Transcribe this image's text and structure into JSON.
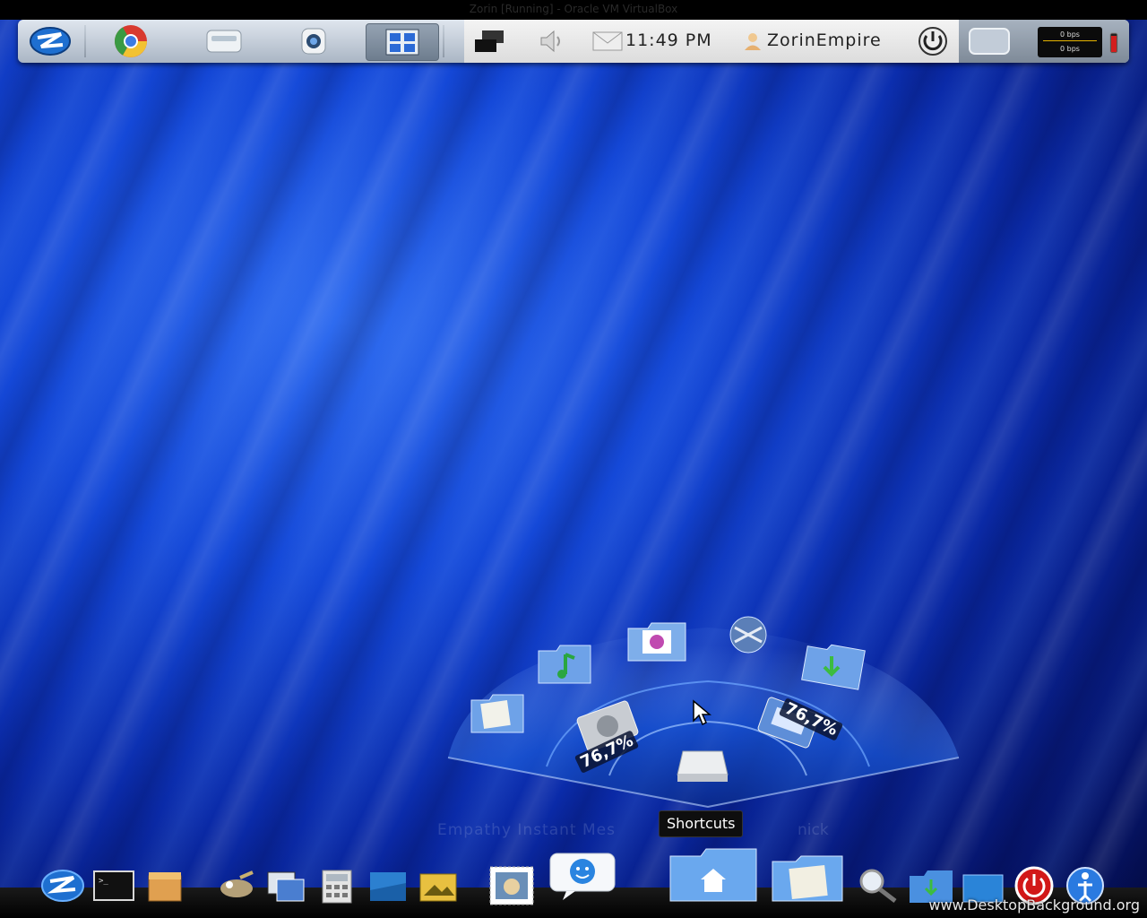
{
  "window": {
    "title": "Zorin [Running] - Oracle VM VirtualBox"
  },
  "top_panel": {
    "launchers": [
      {
        "name": "zorin-menu-icon"
      },
      {
        "name": "chrome-icon"
      },
      {
        "name": "files-drive-icon"
      },
      {
        "name": "webcam-icon"
      },
      {
        "name": "workspace-icon"
      }
    ],
    "tray": {
      "clock": "11:49 PM",
      "user": "ZorinEmpire"
    },
    "netmon": {
      "up": "0 bps",
      "down": "0 bps"
    }
  },
  "stack": {
    "tooltip": "Shortcuts",
    "percent_1": "76,7%",
    "percent_2": "76,7%",
    "ghost_text": "Empathy Instant Mes",
    "ghost_text2": "nick"
  },
  "dock": {
    "items": [
      "zorin-logo-icon",
      "terminal-icon",
      "archive-icon",
      "gimp-icon",
      "screenshot-icon",
      "calculator-icon",
      "document-icon",
      "folder-photos-icon",
      "mail-stamp-icon",
      "empathy-icon",
      "home-folder-icon",
      "documents-folder-icon",
      "search-icon",
      "downloads-folder-icon",
      "desktop-folder-icon",
      "shutdown-icon",
      "help-icon"
    ]
  },
  "watermark": "www.DesktopBackground.org",
  "colors": {
    "panel": "#c4ccd6",
    "wallpaper": "#1448d8",
    "tooltip_bg": "#0e0e0e"
  }
}
